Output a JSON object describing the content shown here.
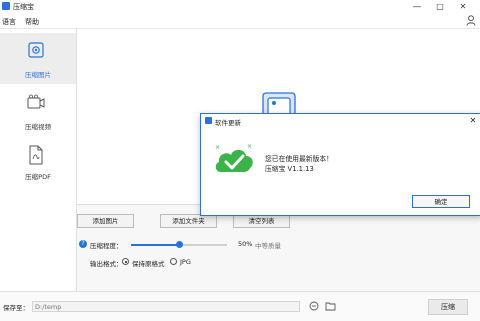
{
  "window": {
    "title": "压缩宝",
    "minimize": "—",
    "maximize": "□",
    "close": "✕"
  },
  "menu": {
    "items": [
      "语言",
      "帮助"
    ]
  },
  "sidebar": {
    "items": [
      {
        "label": "压缩图片",
        "icon": "image-icon",
        "active": true
      },
      {
        "label": "压缩视频",
        "icon": "video-icon",
        "active": false
      },
      {
        "label": "压缩PDF",
        "icon": "pdf-icon",
        "active": false
      }
    ]
  },
  "actions": {
    "add_images": "添加图片",
    "add_folder": "添加文件夹",
    "clear_list": "清空列表"
  },
  "settings": {
    "quality_label": "压缩程度：",
    "quality_value_text": "50%",
    "quality_desc": "中等质量",
    "quality_fraction": 0.5,
    "format_label": "输出格式：",
    "format_options": [
      "保持原格式",
      "JPG"
    ],
    "format_selected": "保持原格式"
  },
  "save": {
    "label": "保存至：",
    "path": "D:/temp",
    "compress_button": "压缩"
  },
  "dialog": {
    "title": "软件更新",
    "close": "✕",
    "message_line1": "您已在使用最新版本！",
    "message_line2": "压缩宝 V1.1.13",
    "ok": "确定"
  },
  "colors": {
    "accent": "#2a73d6",
    "success_green": "#3cb34a",
    "dialog_border": "#2b6fd0"
  }
}
